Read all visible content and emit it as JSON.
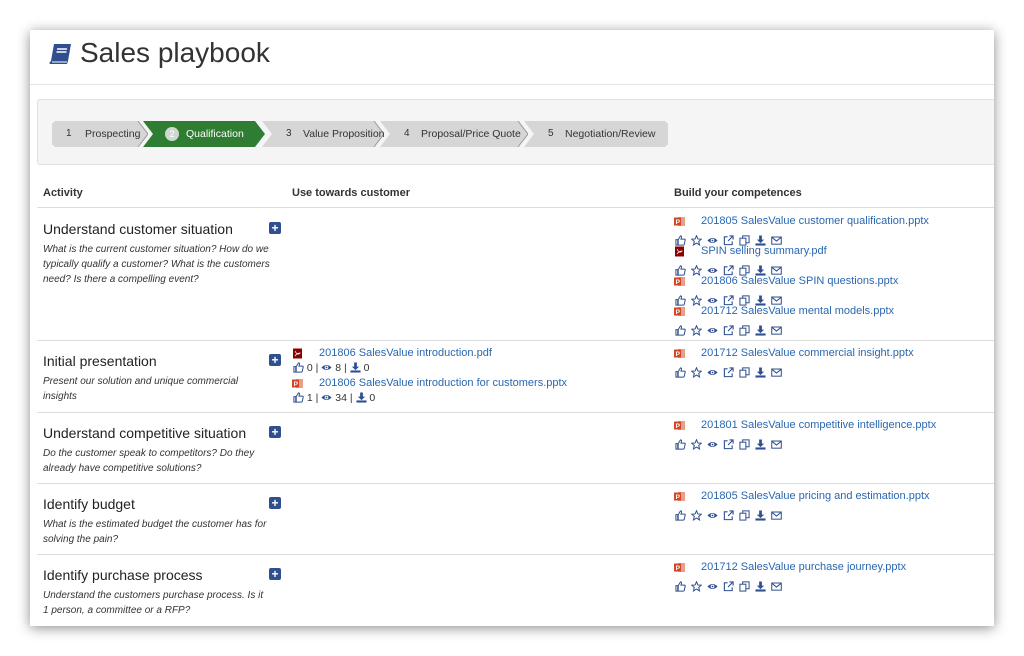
{
  "page": {
    "title": "Sales playbook"
  },
  "steps": [
    {
      "num": "1",
      "label": "Prospecting"
    },
    {
      "num": "2",
      "label": "Qualification"
    },
    {
      "num": "3",
      "label": "Value Proposition"
    },
    {
      "num": "4",
      "label": "Proposal/Price Quote"
    },
    {
      "num": "5",
      "label": "Negotiation/Review"
    }
  ],
  "columns": {
    "activity": "Activity",
    "use": "Use towards customer",
    "build": "Build your competences"
  },
  "activities": [
    {
      "title": "Understand customer situation",
      "desc": "What is the current customer situation? How do we typically qualify a customer? What is the customers need? Is there a compelling event?",
      "use": [],
      "build": [
        {
          "name": "201805 SalesValue customer qualification.pptx",
          "type": "pptx"
        },
        {
          "name": "SPIN selling summary.pdf",
          "type": "pdf"
        },
        {
          "name": "201806 SalesValue SPIN questions.pptx",
          "type": "pptx"
        },
        {
          "name": "201712 SalesValue mental models.pptx",
          "type": "pptx"
        }
      ]
    },
    {
      "title": "Initial presentation",
      "desc": "Present our solution and unique commercial insights",
      "use": [
        {
          "name": "201806 SalesValue introduction.pdf",
          "type": "pdf",
          "likes": "0",
          "views": "8",
          "downloads": "0"
        },
        {
          "name": "201806 SalesValue introduction for customers.pptx",
          "type": "pptx",
          "likes": "1",
          "views": "34",
          "downloads": "0"
        }
      ],
      "build": [
        {
          "name": "201712 SalesValue commercial insight.pptx",
          "type": "pptx"
        }
      ]
    },
    {
      "title": "Understand competitive situation",
      "desc": "Do the customer speak to competitors? Do they already have competitive solutions?",
      "use": [],
      "build": [
        {
          "name": "201801 SalesValue competitive intelligence.pptx",
          "type": "pptx"
        }
      ]
    },
    {
      "title": "Identify budget",
      "desc": "What is the estimated budget the customer has for solving the pain?",
      "use": [],
      "build": [
        {
          "name": "201805 SalesValue pricing and estimation.pptx",
          "type": "pptx"
        }
      ]
    },
    {
      "title": "Identify purchase process",
      "desc": "Understand the customers purchase process. Is it 1 person, a committee or a RFP?",
      "use": [],
      "build": [
        {
          "name": "201712 SalesValue purchase journey.pptx",
          "type": "pptx"
        }
      ]
    }
  ],
  "colors": {
    "accent": "#2a67b1",
    "active_step": "#2e7d32",
    "step_bg": "#d6d6d6",
    "pptx": "#d24726",
    "pdf": "#8b0000",
    "icon": "#2f4f8f"
  }
}
